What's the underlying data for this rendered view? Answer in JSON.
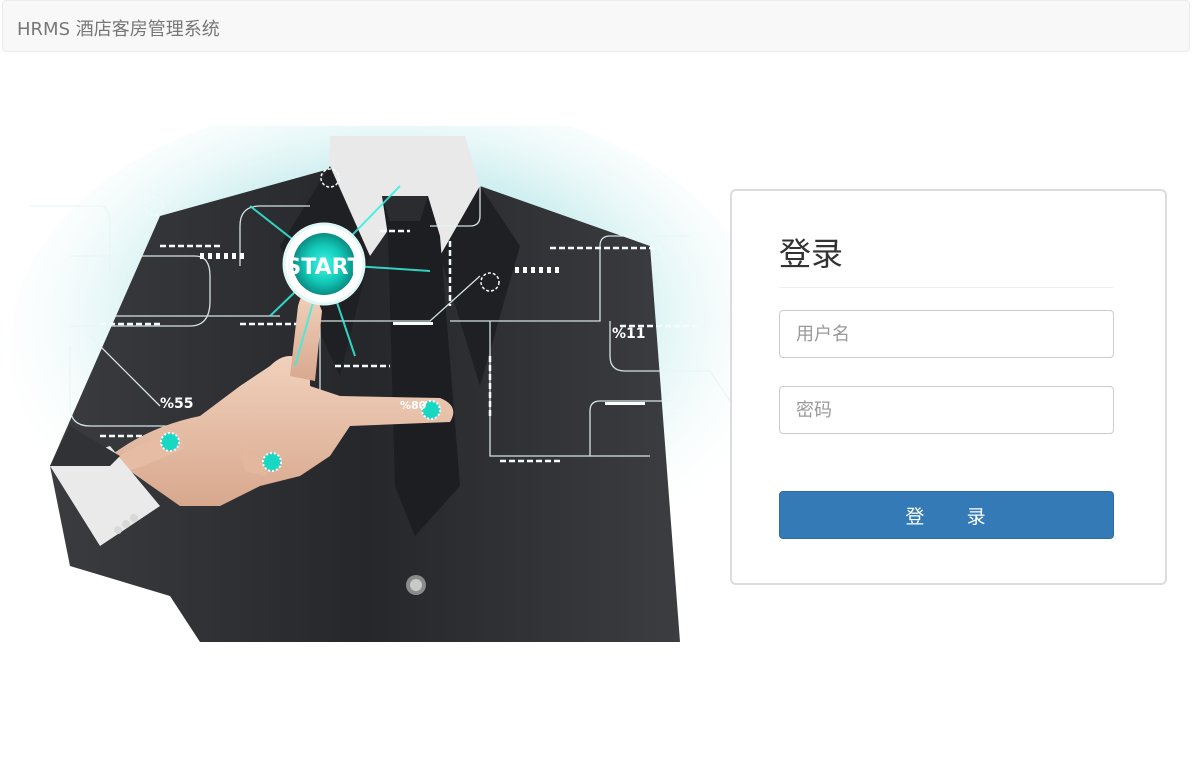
{
  "app": {
    "brand": "HRMS 酒店客房管理系统"
  },
  "hero": {
    "start_label": "START",
    "readouts": [
      "%11",
      "%55",
      "%80"
    ]
  },
  "login": {
    "title": "登录",
    "username": {
      "value": "",
      "placeholder": "用户名"
    },
    "password": {
      "value": "",
      "placeholder": "密码"
    },
    "submit_label": "登     录"
  },
  "colors": {
    "accent": "#337ab7",
    "glow": "#18d8c4",
    "suit": "#2a2b2e"
  },
  "icons": [
    "start-button-icon",
    "touch-point-icon"
  ]
}
